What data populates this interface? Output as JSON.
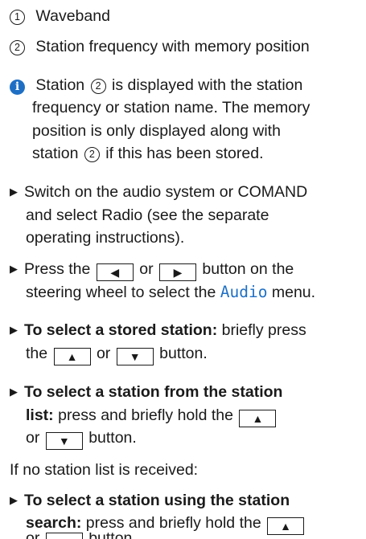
{
  "items": [
    {
      "num": "1",
      "text": "Waveband"
    },
    {
      "num": "2",
      "text": "Station frequency with memory position"
    }
  ],
  "note": {
    "icon": "info-icon",
    "l1a": "Station",
    "l1num": "2",
    "l1b": "is displayed with the station",
    "l2": "frequency or station name. The memory",
    "l3": "position is only displayed along with",
    "l4a": "station",
    "l4num": "2",
    "l4b": "if this has been stored."
  },
  "steps": {
    "s1l1": "Switch on the audio system or COMAND",
    "s1l2": "and select Radio (see the separate",
    "s1l3": "operating instructions).",
    "s2a": "Press the",
    "s2b": "or",
    "s2c": "button on the",
    "s2l2a": "steering wheel to select the",
    "s2menu": "Audio",
    "s2l2b": "menu.",
    "s3bold": "To select a stored station:",
    "s3a": "briefly press",
    "s3l2a": "the",
    "s3l2b": "or",
    "s3l2c": "button.",
    "s4bold1": "To select a station from the station",
    "s4bold2": "list:",
    "s4a": "press and briefly hold the",
    "s4l3a": "or",
    "s4l3b": "button.",
    "cond": "If no station list is received:",
    "s5bold1": "To select a station using the station",
    "s5bold2": "search:",
    "s5a": "press and briefly hold the",
    "s5l3a": "or",
    "s5l3b": "button."
  },
  "glyphs": {
    "left": "◀",
    "right": "▶",
    "up": "▲",
    "down": "▼",
    "bullet": "▶"
  }
}
